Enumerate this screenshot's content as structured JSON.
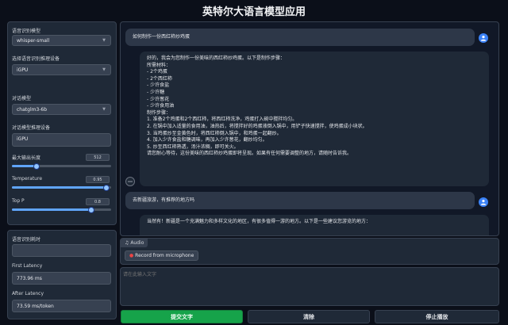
{
  "app_title": "英特尔大语言模型应用",
  "sidebar": {
    "speech_model_label": "语音识别模型",
    "speech_model_value": "whisper-small",
    "speech_device_label": "选择语音识别推理设备",
    "speech_device_value": "iGPU",
    "chat_model_label": "对话模型",
    "chat_model_value": "chatglm3-6b",
    "chat_device_label": "对话模型推理设备",
    "chat_device_value": "iGPU",
    "max_length_label": "最大输出长度",
    "max_length_value": "512",
    "max_length_fraction": 0.25,
    "temperature_label": "Temperature",
    "temperature_value": "0.95",
    "temperature_fraction": 0.95,
    "top_p_label": "Top P",
    "top_p_value": "0.8",
    "top_p_fraction": 0.8
  },
  "metrics": {
    "speech_time_label": "语音识别耗时",
    "speech_time_value": "",
    "first_latency_label": "First Latency",
    "first_latency_value": "773.96 ms",
    "after_latency_label": "After Latency",
    "after_latency_value": "73.59 ms/token"
  },
  "chat": {
    "messages": [
      {
        "role": "user",
        "text": "如何制作一份西红柿炒鸡蛋"
      },
      {
        "role": "bot",
        "lines": [
          "好的，我会为您制作一份美味的西红柿炒鸡蛋。以下是制作步骤：",
          "所需材料：",
          "- 2个鸡蛋",
          "- 2个西红柿",
          "- 少许食盐",
          "- 少许糖",
          "- 少许葱花",
          "- 少许食用油",
          "制作步骤：",
          "1. 准备2个鸡蛋和2个西红柿，将西红柿洗净，鸡蛋打入碗中搅拌均匀。",
          "2. 在锅中加入适量的食用油，油热后，将搅拌好的鸡蛋液倒入锅中，用铲子快速搅拌，使鸡蛋成小块状。",
          "3. 当鸡蛋炒至金黄色时，将西红柿倒入锅中，和鸡蛋一起翻炒。",
          "4. 加入少许食盐和糖调味，再加入少许葱花，翻炒均匀。",
          "5. 炒至西红柿熟透，汤汁浓稠，即可关火。",
          "请您耐心等待，这份美味的西红柿炒鸡蛋即将呈现。如果有任何需要调整的地方，请随时告诉我。"
        ]
      },
      {
        "role": "user",
        "text": "去新疆旅游，有推荐的地方吗"
      },
      {
        "role": "bot",
        "lines": [
          "当然有！新疆是一个充满魅力和多样文化的地区，有很多值得一游的地方。以下是一些建议您游览的地方："
        ]
      }
    ]
  },
  "audio": {
    "tag": "Audio",
    "record_label": "Record from microphone"
  },
  "text_input": {
    "placeholder": "请在此输入文字"
  },
  "buttons": {
    "submit": "提交文字",
    "clear": "清除",
    "stop": "停止播放"
  },
  "colors": {
    "background": "#0b0f19",
    "panel": "#1f2937",
    "accent": "#60a5fa",
    "submit_button": "#16a34a"
  }
}
